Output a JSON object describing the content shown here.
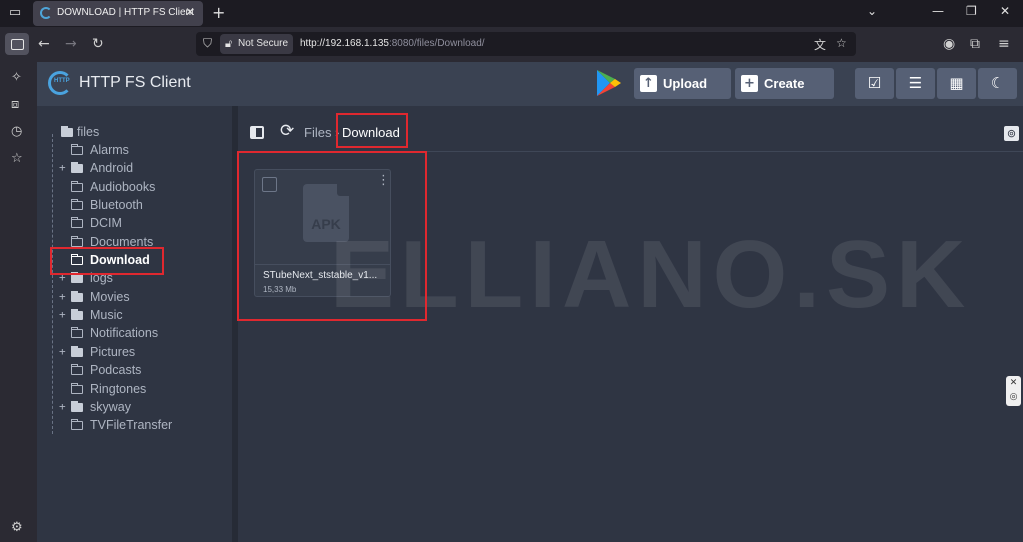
{
  "browser": {
    "tab_title": "DOWNLOAD | HTTP FS Client",
    "not_secure": "Not Secure",
    "url_host": "http://192.168.1.135",
    "url_rest": ":8080/files/Download/"
  },
  "app": {
    "title": "HTTP FS Client",
    "logo_text": "HTTP",
    "upload_label": "Upload",
    "create_label": "Create"
  },
  "tree": {
    "root": "files",
    "items": [
      {
        "label": "Alarms",
        "expandable": false
      },
      {
        "label": "Android",
        "expandable": true
      },
      {
        "label": "Audiobooks",
        "expandable": false
      },
      {
        "label": "Bluetooth",
        "expandable": false
      },
      {
        "label": "DCIM",
        "expandable": false
      },
      {
        "label": "Documents",
        "expandable": false
      },
      {
        "label": "Download",
        "expandable": false,
        "active": true
      },
      {
        "label": "logs",
        "expandable": true
      },
      {
        "label": "Movies",
        "expandable": true
      },
      {
        "label": "Music",
        "expandable": true
      },
      {
        "label": "Notifications",
        "expandable": false
      },
      {
        "label": "Pictures",
        "expandable": true
      },
      {
        "label": "Podcasts",
        "expandable": false
      },
      {
        "label": "Ringtones",
        "expandable": false
      },
      {
        "label": "skyway",
        "expandable": true
      },
      {
        "label": "TVFileTransfer",
        "expandable": false
      }
    ]
  },
  "breadcrumb": {
    "files": "Files",
    "separator": "›",
    "current": "Download"
  },
  "file_card": {
    "type_label": "APK",
    "name": "STubeNext_ststable_v1...",
    "size": "15,33 Mb"
  },
  "watermark": "ELLIANO.SK",
  "colors": {
    "accent": "#4aa3df",
    "highlight": "#e0282f",
    "button": "#566075"
  }
}
